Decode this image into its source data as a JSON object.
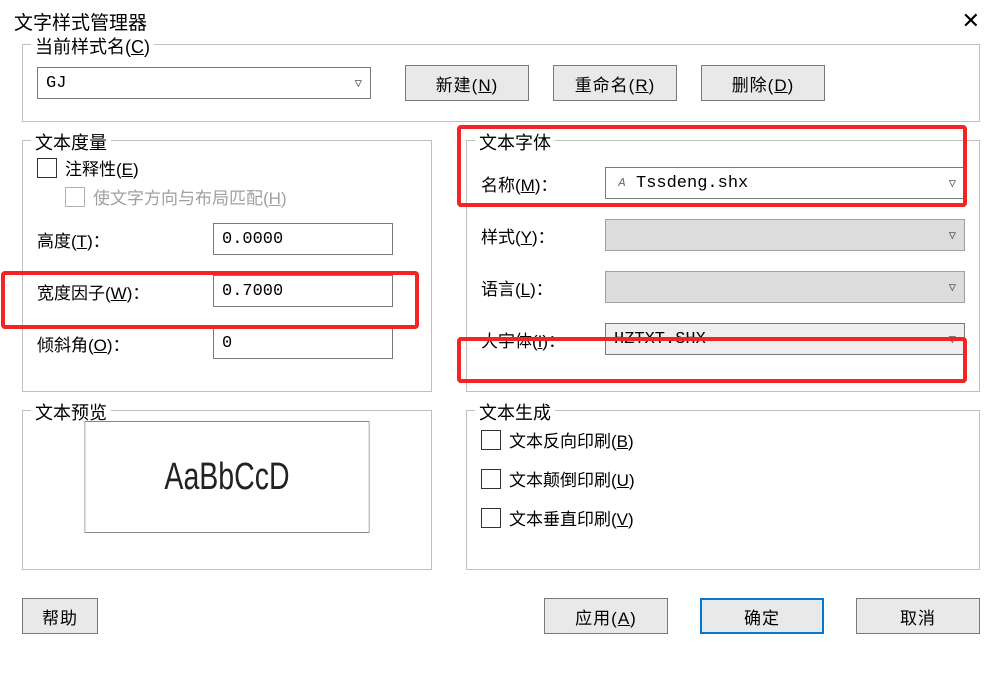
{
  "title": "文字样式管理器",
  "currentStyle": {
    "legend": "当前样式名(C)",
    "value": "GJ"
  },
  "buttons": {
    "new": "新建(N)",
    "rename": "重命名(R)",
    "delete": "删除(D)",
    "help": "帮助",
    "apply": "应用(A)",
    "ok": "确定",
    "cancel": "取消"
  },
  "metrics": {
    "legend": "文本度量",
    "annotative": "注释性(E)",
    "matchOrientation": "使文字方向与布局匹配(H)",
    "heightLabel": "高度(T)：",
    "heightValue": "0.0000",
    "widthLabel": "宽度因子(W)：",
    "widthValue": "0.7000",
    "obliqueLabel": "倾斜角(O)：",
    "obliqueValue": "0"
  },
  "font": {
    "legend": "文本字体",
    "nameLabel": "名称(M)：",
    "nameValue": "Tssdeng.shx",
    "styleLabel": "样式(Y)：",
    "styleValue": "",
    "langLabel": "语言(L)：",
    "langValue": "",
    "bigFontLabel": "大字体(I)：",
    "bigFontValue": "HZTXT.SHX"
  },
  "preview": {
    "legend": "文本预览",
    "sample": "AaBbCcD"
  },
  "generate": {
    "legend": "文本生成",
    "backward": "文本反向印刷(B)",
    "upsideDown": "文本颠倒印刷(U)",
    "vertical": "文本垂直印刷(V)"
  }
}
